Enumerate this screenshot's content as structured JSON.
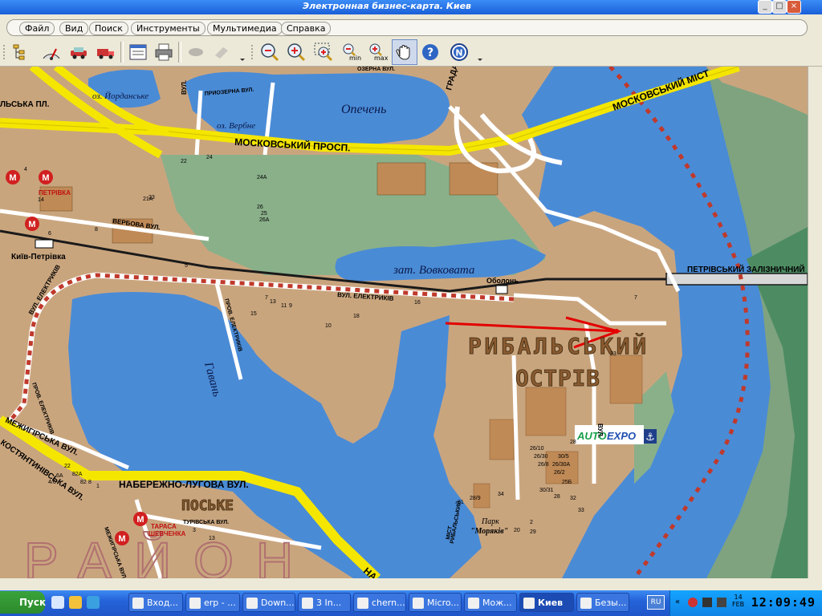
{
  "window": {
    "title": "Электронная бизнес-карта. Киев"
  },
  "menu": [
    "Файл",
    "Вид",
    "Поиск",
    "Инструменты",
    "Мультимедиа",
    "Справка"
  ],
  "toolbar": {
    "buttons": [
      "layers-tree",
      "measure-distance",
      "route-car",
      "route-truck",
      "info-panel",
      "print",
      "eraser-disabled",
      "eraser2-disabled",
      "zoom-out",
      "zoom-in",
      "zoom-window",
      "zoom-min",
      "zoom-max",
      "pan-hand",
      "help",
      "north"
    ],
    "zoom_min_label": "min",
    "zoom_max_label": "max"
  },
  "map": {
    "street_labels": {
      "moskovskyi_prosp": "МОСКОВСЬКИЙ ПРОСП.",
      "moskovskyi_mist": "МОСКОВСЬКИЙ МІСТ",
      "naberezhno_luhova": "НАБЕРЕЖНО-ЛУГОВА ВУЛ.",
      "mezhyhirska": "МЕЖИГІРСЬКА ВУЛ.",
      "kostiantynivska": "КОСТЯНТИНІВСЬКА ВУЛ.",
      "verbova": "ВЕРБОВА ВУЛ.",
      "elektrykiv": "ВУЛ. ЕЛЕКТРИКІВ",
      "elektrykiv2": "ВУЛ. ЕЛЕКТРИКІВ",
      "prov_elektrykiv": "ПРОВ. ЕЛЕКТРИКІВ",
      "prov_elektrykiv2": "ПРОВ. ЕЛЕКТРИКІВ",
      "petrivskyi_zal": "ПЕТРІВСЬКИЙ ЗАЛІЗНИЧНИЙ",
      "pryozerna": "ПРИОЗЕРНА ВУЛ.",
      "ozerna": "ОЗЕРНА ВУЛ.",
      "vul": "ВУЛ.",
      "vul2": "ВУЛ.",
      "turivska": "ТУРІВСЬКА ВУЛ.",
      "hrada": "ГРАДА",
      "mezhyhirska2": "МЕЖИГІРСЬКА ВУЛ.",
      "mist": "МІСТ",
      "rybalskyi": "РИБАЛЬСЬКИЙ",
      "na": "НА",
      "pl": "ЛЬСЬКА ПЛ."
    },
    "water_labels": {
      "opechen": "Опечень",
      "vovkovata": "зат. Вовковата",
      "havan": "Гавань",
      "yordanske": "оз. Йорданське",
      "verbne": "оз. Вербне"
    },
    "place_labels": {
      "island_line1": "РИБАЛЬСЬКИЙ",
      "island_line2": "ОСТРІВ",
      "podil": "ПОСЬКЕ",
      "rayon": "РАЙОН",
      "park": "Парк",
      "park2": "\"Моряків\""
    },
    "stations": {
      "petrivka": "ПЕТРІВКА",
      "kyiv_petrivka": "Київ-Петрівка",
      "obolon": "Оболонь",
      "taras1": "ТАРАСА",
      "taras2": "ШЕВЧЕНКА",
      "metro": "М"
    },
    "house_numbers": [
      "22",
      "24",
      "24А",
      "23",
      "25",
      "26",
      "26А",
      "21А",
      "14",
      "4",
      "8",
      "6",
      "5",
      "7",
      "9",
      "11",
      "13",
      "15",
      "16",
      "10",
      "18",
      "28/9",
      "31",
      "34",
      "26/10",
      "26/30",
      "30/5",
      "28",
      "25Б",
      "26/8",
      "26/30А",
      "26/2",
      "23",
      "30/31",
      "28",
      "32",
      "33",
      "20",
      "29",
      "2",
      "7",
      "22",
      "6А",
      "4/6",
      "82А",
      "82",
      "8",
      "1",
      "3",
      "13"
    ],
    "logo": {
      "text_auto": "AUTO",
      "text_expo": "EXPO"
    }
  },
  "taskbar": {
    "start": "Пуск",
    "tasks": [
      "Вход...",
      "erp - ...",
      "Down...",
      "3 In...",
      "chern...",
      "Micro...",
      "Мож...",
      "Киев",
      "Безы..."
    ],
    "lang": "RU",
    "date_day": "14",
    "date_month": "FEB",
    "time": "12:09:49"
  },
  "colors": {
    "water": "#4a8bd6",
    "land": "#c9a57e",
    "green": "#8ab08a",
    "road_yellow": "#f5e600",
    "boundary": "#c0392b",
    "taskbar": "#2563d9"
  }
}
